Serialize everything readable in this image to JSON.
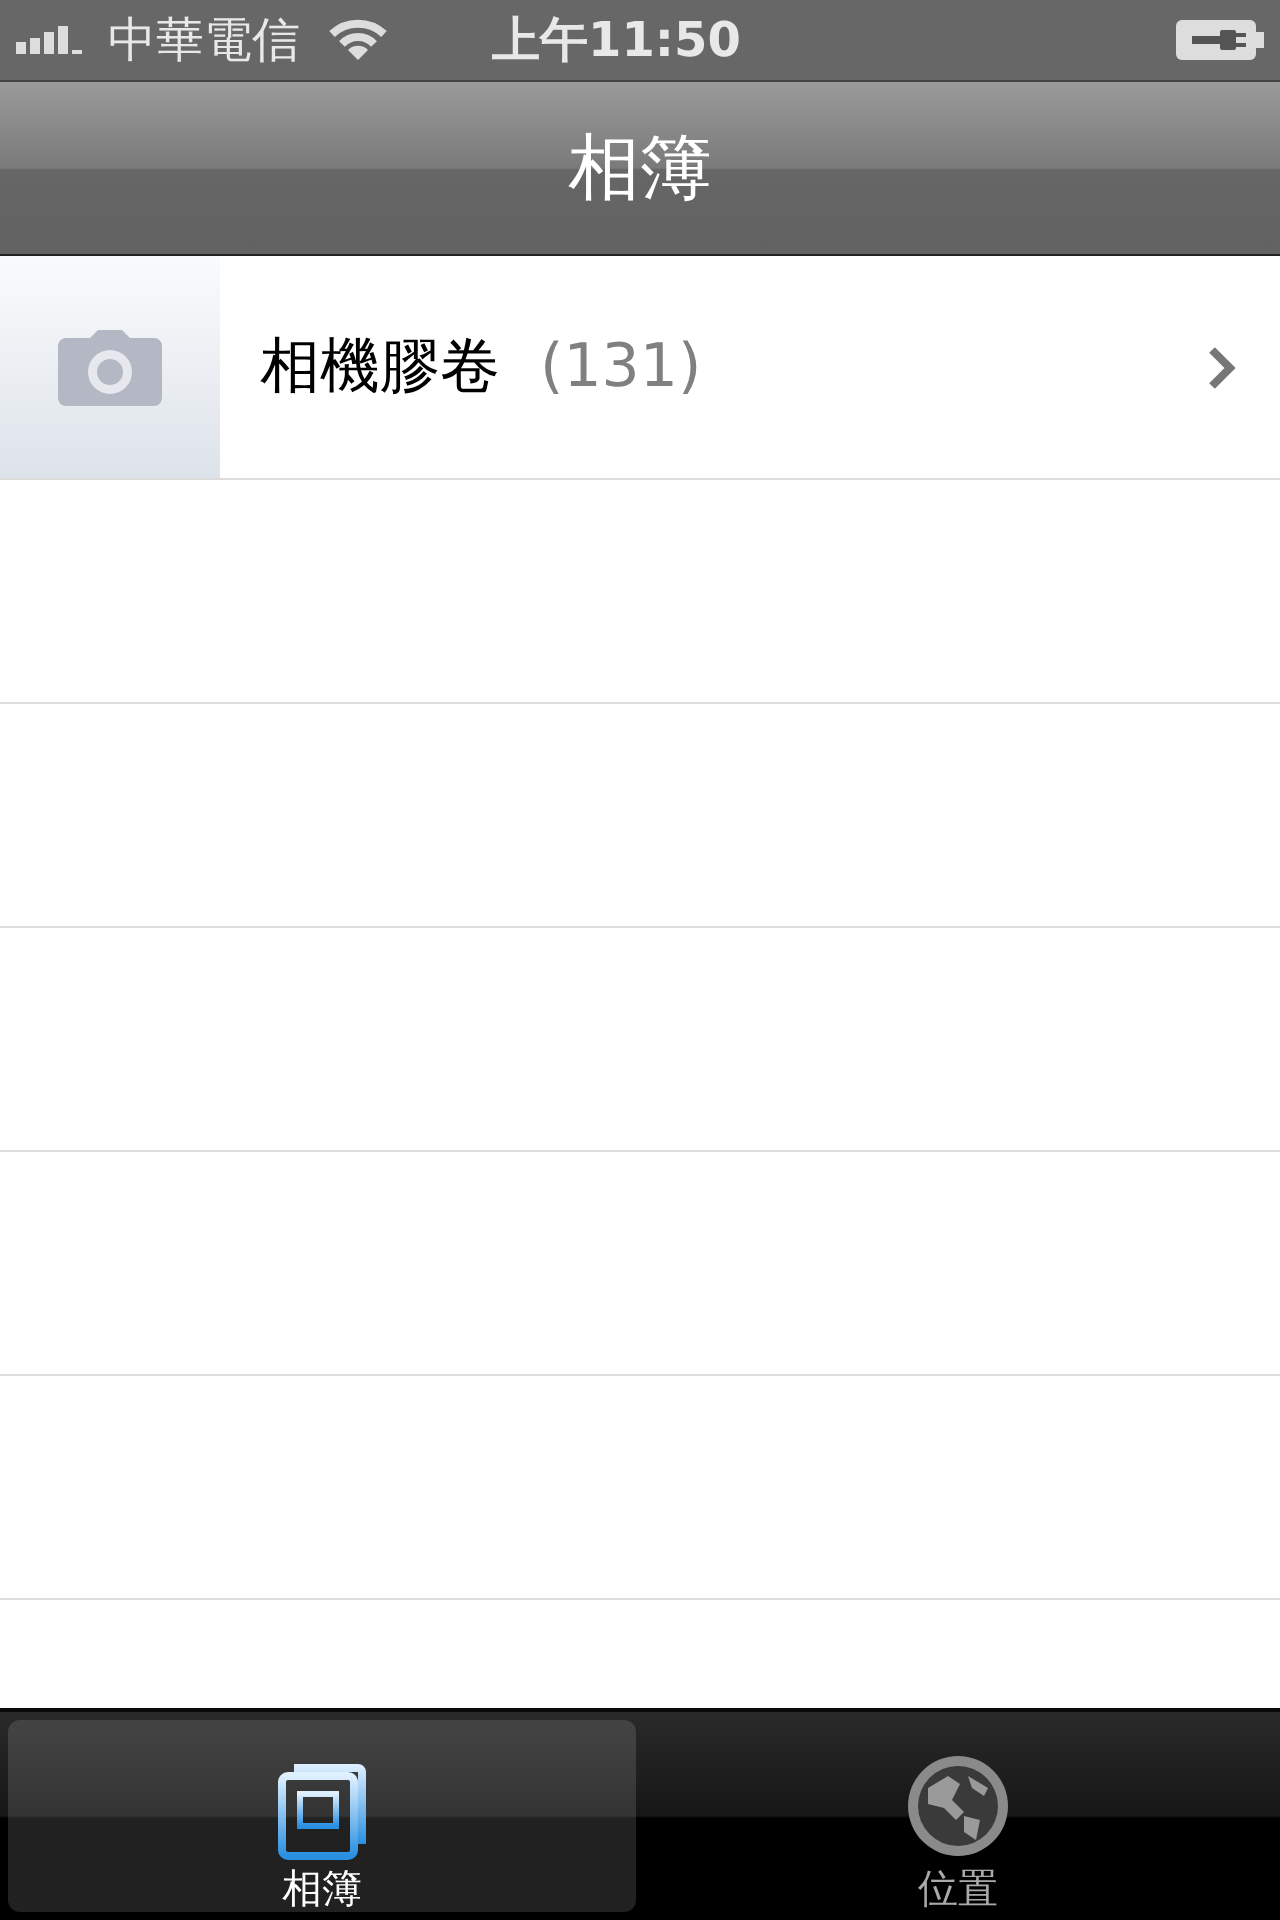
{
  "status_bar": {
    "carrier": "中華電信",
    "time": "上午11:50"
  },
  "nav_bar": {
    "title": "相簿"
  },
  "albums": [
    {
      "kind": "camera",
      "name": "相機膠卷",
      "count": "(131)"
    }
  ],
  "tab_bar": [
    {
      "kind": "album",
      "label": "相簿",
      "selected": true
    },
    {
      "kind": "globe",
      "label": "位置",
      "selected": false
    }
  ]
}
